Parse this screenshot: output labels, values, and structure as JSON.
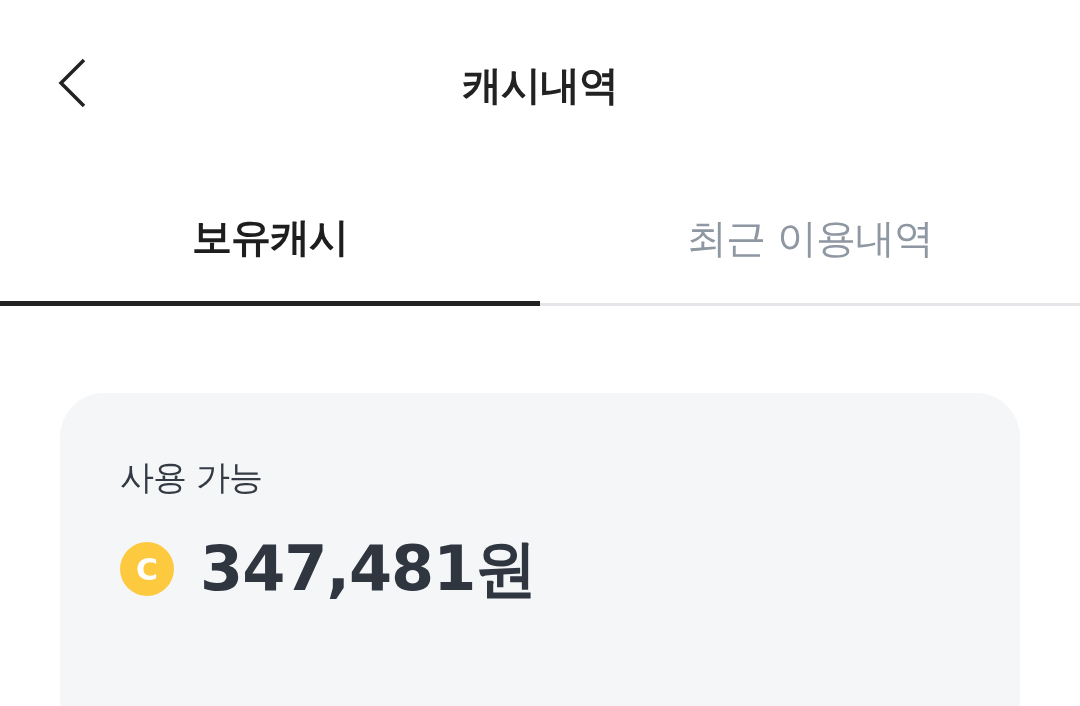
{
  "header": {
    "title": "캐시내역"
  },
  "tabs": [
    {
      "label": "보유캐시",
      "selected": true
    },
    {
      "label": "최근 이용내역",
      "selected": false
    }
  ],
  "balance": {
    "label": "사용 가능",
    "amount": "347,481원",
    "coin": "C"
  }
}
